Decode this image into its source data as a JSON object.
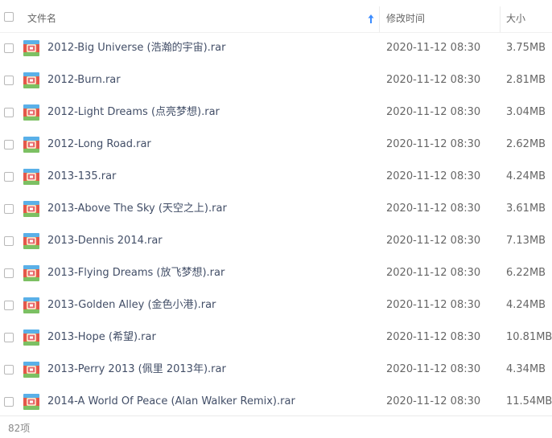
{
  "header": {
    "name_label": "文件名",
    "time_label": "修改时间",
    "size_label": "大小",
    "sort_indicator": "arrow-up-icon"
  },
  "files": [
    {
      "name": "2012-Big Universe (浩瀚的宇宙).rar",
      "time": "2020-11-12 08:30",
      "size": "3.75MB",
      "icon": "rar-archive-icon"
    },
    {
      "name": "2012-Burn.rar",
      "time": "2020-11-12 08:30",
      "size": "2.81MB",
      "icon": "rar-archive-icon"
    },
    {
      "name": "2012-Light Dreams (点亮梦想).rar",
      "time": "2020-11-12 08:30",
      "size": "3.04MB",
      "icon": "rar-archive-icon"
    },
    {
      "name": "2012-Long Road.rar",
      "time": "2020-11-12 08:30",
      "size": "2.62MB",
      "icon": "rar-archive-icon"
    },
    {
      "name": "2013-135.rar",
      "time": "2020-11-12 08:30",
      "size": "4.24MB",
      "icon": "rar-archive-icon"
    },
    {
      "name": "2013-Above The Sky (天空之上).rar",
      "time": "2020-11-12 08:30",
      "size": "3.61MB",
      "icon": "rar-archive-icon"
    },
    {
      "name": "2013-Dennis 2014.rar",
      "time": "2020-11-12 08:30",
      "size": "7.13MB",
      "icon": "rar-archive-icon"
    },
    {
      "name": "2013-Flying Dreams (放飞梦想).rar",
      "time": "2020-11-12 08:30",
      "size": "6.22MB",
      "icon": "rar-archive-icon"
    },
    {
      "name": "2013-Golden Alley (金色小港).rar",
      "time": "2020-11-12 08:30",
      "size": "4.24MB",
      "icon": "rar-archive-icon"
    },
    {
      "name": "2013-Hope (希望).rar",
      "time": "2020-11-12 08:30",
      "size": "10.81MB",
      "icon": "rar-archive-icon"
    },
    {
      "name": "2013-Perry 2013 (佩里 2013年).rar",
      "time": "2020-11-12 08:30",
      "size": "4.34MB",
      "icon": "rar-archive-icon"
    },
    {
      "name": "2014-A World Of Peace (Alan Walker Remix).rar",
      "time": "2020-11-12 08:30",
      "size": "11.54MB",
      "icon": "rar-archive-icon"
    }
  ],
  "footer": {
    "count_text": "82项"
  },
  "colors": {
    "sort_arrow": "#3b8cff",
    "filename_text": "#424e67",
    "meta_text": "#666666"
  }
}
